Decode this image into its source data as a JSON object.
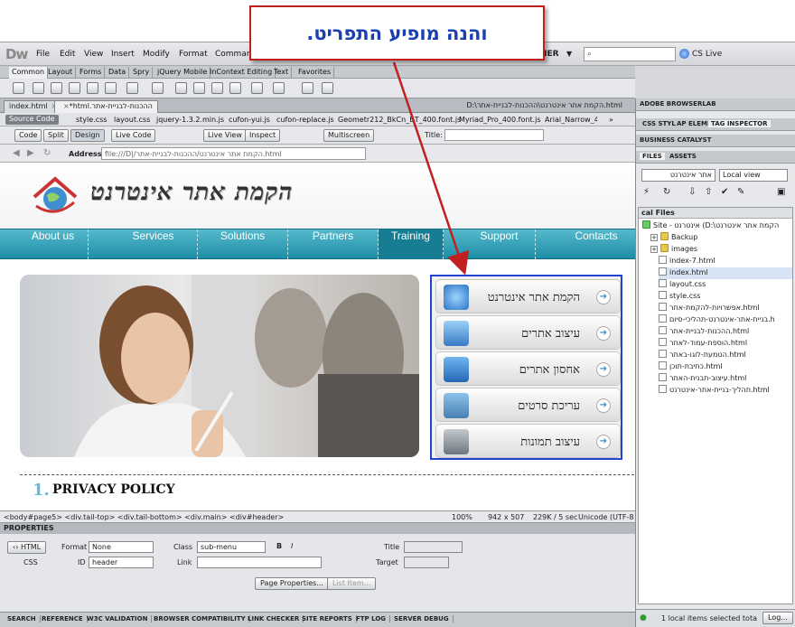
{
  "callout": {
    "text": "והנה מופיע התפריט."
  },
  "app": {
    "logo": "Dw",
    "menus": [
      "File",
      "Edit",
      "View",
      "Insert",
      "Modify",
      "Format",
      "Command"
    ],
    "workspace": "NER",
    "cs_live": "CS Live"
  },
  "insert_tabs": [
    "Common",
    "Layout",
    "Forms",
    "Data",
    "Spry",
    "jQuery Mobile",
    "InContext Editing",
    "Text",
    "Favorites"
  ],
  "doc_tabs": [
    {
      "label": "index.html"
    },
    {
      "label": "ההכנות-לבניית-אתר.html*"
    }
  ],
  "doc_path": "D:\\הקמת אתר אינטרנט\\ההכנות-לבניית-אתר.html",
  "related_files": {
    "source_code": "Source Code",
    "files": [
      "style.css",
      "layout.css",
      "jquery-1.3.2.min.js",
      "cufon-yui.js",
      "cufon-replace.js",
      "Geometr212_BkCn_BT_400.font.js",
      "Myriad_Pro_400.font.js",
      "Arial_Narrow_4"
    ]
  },
  "doc_toolbar": {
    "buttons": [
      "Code",
      "Split",
      "Design",
      "Live Code",
      "Live View",
      "Inspect",
      "Multiscreen"
    ],
    "title_label": "Title:"
  },
  "address": {
    "label": "Address:",
    "value": "file:///D|/הקמת אתר אינטרנט/ההכנות-לבניית-אתר.html"
  },
  "site": {
    "title": "הקמת אתר אינטרנט",
    "nav": [
      "About us",
      "Services",
      "Solutions",
      "Partners",
      "Training",
      "Support",
      "Contacts"
    ],
    "active_nav": "Training",
    "submenu": [
      {
        "label": "הקמת אתר אינטרנט",
        "icon": "globe-icon"
      },
      {
        "label": "עיצוב אתרים",
        "icon": "web-design-icon"
      },
      {
        "label": "אחסון אתרים",
        "icon": "network-icon"
      },
      {
        "label": "עריכת סרטים",
        "icon": "video-camera-icon"
      },
      {
        "label": "עיצוב תמונות",
        "icon": "photo-camera-icon"
      }
    ],
    "privacy_number": "1.",
    "privacy_title": "PRIVACY POLICY"
  },
  "tag_selector": {
    "path": "<body#page5> <div.tail-top> <div.tail-bottom> <div.main> <div#header>",
    "zoom": "100%",
    "size": "942 x 507",
    "file_info": "229K / 5 sec",
    "encoding": "Unicode (UTF-8"
  },
  "properties": {
    "header": "PROPERTIES",
    "html_label": "HTML",
    "css_label": "CSS",
    "format_label": "Format",
    "format_value": "None",
    "class_label": "Class",
    "class_value": "sub-menu",
    "id_label": "ID",
    "id_value": "header",
    "link_label": "Link",
    "title_label": "Title",
    "target_label": "Target",
    "page_properties": "Page Properties...",
    "list_item": "List Item..."
  },
  "bottom_tabs": [
    "SEARCH",
    "REFERENCE",
    "W3C VALIDATION",
    "BROWSER COMPATIBILITY",
    "LINK CHECKER",
    "SITE REPORTS",
    "FTP LOG",
    "SERVER DEBUG"
  ],
  "right_panel": {
    "browserlab": "ADOBE BROWSERLAB",
    "tabs": [
      "CSS STYL",
      "AP ELEME",
      "TAG INSPECTOR"
    ],
    "business_catalyst": "BUSINESS CATALYST",
    "files_tabs": [
      "FILES",
      "ASSETS"
    ],
    "site_select": "אתר אינטרנט",
    "view_select": "Local view",
    "local_files": "cal Files",
    "tree": [
      {
        "label": "Site - אינטרנט (D:\\הקמת אתר אינטרנט",
        "kind": "site",
        "indent": 0,
        "plus": false
      },
      {
        "label": "Backup",
        "kind": "folder",
        "indent": 1,
        "plus": true
      },
      {
        "label": "images",
        "kind": "folder",
        "indent": 1,
        "plus": true
      },
      {
        "label": "index-7.html",
        "kind": "file",
        "indent": 2,
        "plus": false
      },
      {
        "label": "index.html",
        "kind": "file",
        "indent": 2,
        "plus": false
      },
      {
        "label": "layout.css",
        "kind": "file",
        "indent": 2,
        "plus": false
      },
      {
        "label": "style.css",
        "kind": "file",
        "indent": 2,
        "plus": false
      },
      {
        "label": "אפשרויות-להקמת-אתר.html",
        "kind": "file",
        "indent": 2,
        "plus": false
      },
      {
        "label": "בניית-אתר-אינטרנט-תהליכי-סיום.h",
        "kind": "file",
        "indent": 2,
        "plus": false
      },
      {
        "label": "ההכנות-לבניית-אתר.html",
        "kind": "file",
        "indent": 2,
        "plus": false
      },
      {
        "label": "הוספת-עמוד-לאתר.html",
        "kind": "file",
        "indent": 2,
        "plus": false
      },
      {
        "label": "הטמעת-לוגו-באתר.html",
        "kind": "file",
        "indent": 2,
        "plus": false
      },
      {
        "label": "כתיבת-תוכן.html",
        "kind": "file",
        "indent": 2,
        "plus": false
      },
      {
        "label": "עיצוב-תבנית-האתר.html",
        "kind": "file",
        "indent": 2,
        "plus": false
      },
      {
        "label": "תהליך-בניית-אתר-אינטרנט.html",
        "kind": "file",
        "indent": 2,
        "plus": false
      }
    ],
    "status": "1 local items selected tota",
    "log_button": "Log..."
  }
}
